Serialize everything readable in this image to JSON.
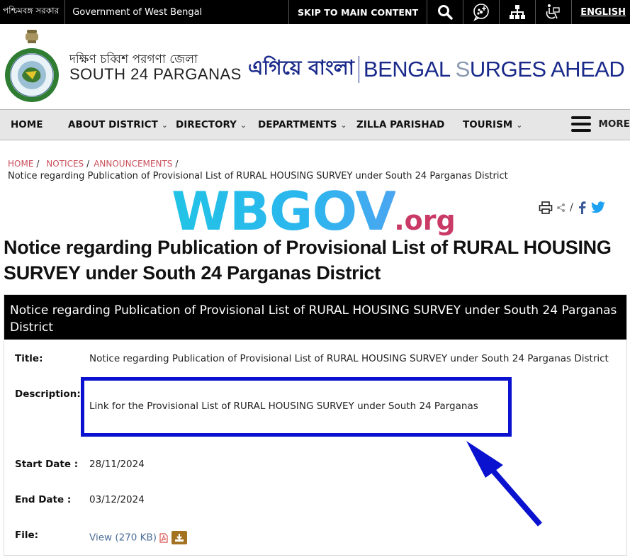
{
  "topbar": {
    "state_bn": "পশ্চিমবঙ্গ সরকার",
    "state_en": "Government of West Bengal",
    "skip_label": "SKIP TO MAIN CONTENT",
    "icons": [
      "search-icon",
      "social-media-icon",
      "sitemap-icon",
      "accessibility-icon"
    ],
    "language": "ENGLISH"
  },
  "header": {
    "district_bn": "দক্ষিণ চব্বিশ পরগণা জেলা",
    "district_en": "SOUTH 24 PARGANAS",
    "slogan_bn": "এগিয়ে বাংলা",
    "slogan_en_1": "BENGAL ",
    "slogan_en_2": "S",
    "slogan_en_3": "URGES AHEAD"
  },
  "nav": {
    "items": [
      {
        "label": "HOME",
        "has_dropdown": false
      },
      {
        "label": "ABOUT DISTRICT",
        "has_dropdown": true
      },
      {
        "label": "DIRECTORY",
        "has_dropdown": true
      },
      {
        "label": "DEPARTMENTS",
        "has_dropdown": true
      },
      {
        "label": "ZILLA PARISHAD",
        "has_dropdown": false
      },
      {
        "label": "TOURISM",
        "has_dropdown": true
      }
    ],
    "more_label": "MORE",
    "chevron": "⌄"
  },
  "breadcrumb": {
    "items": [
      "HOME",
      "NOTICES",
      "ANNOUNCEMENTS"
    ],
    "separator": "/",
    "current": "Notice regarding Publication of Provisional List of RURAL HOUSING SURVEY under South 24 Parganas District"
  },
  "watermark": {
    "main": "WBGOV",
    "suffix": ".org"
  },
  "share": {
    "separator": "/"
  },
  "page_title": "Notice regarding Publication of Provisional List of RURAL HOUSING SURVEY under South 24 Parganas District",
  "notice": {
    "heading": "Notice regarding Publication of Provisional List of RURAL HOUSING SURVEY under South 24 Parganas District",
    "title_label": "Title:",
    "title_value": "Notice regarding Publication of Provisional List of RURAL HOUSING SURVEY under South 24 Parganas District",
    "description_label": "Description:",
    "description_link": "Link for the Provisional List of RURAL HOUSING SURVEY under South 24 Parganas",
    "start_label": "Start Date :",
    "start_value": "28/11/2024",
    "end_label": "End Date :",
    "end_value": "03/12/2024",
    "file_label": "File:",
    "file_link": "View (270 KB)"
  },
  "colors": {
    "highlight": "#0a12cf",
    "breadcrumb_link": "#c9505c",
    "link": "#4a6d97",
    "slogan": "#1a2a8a",
    "download_button": "#a37321"
  }
}
